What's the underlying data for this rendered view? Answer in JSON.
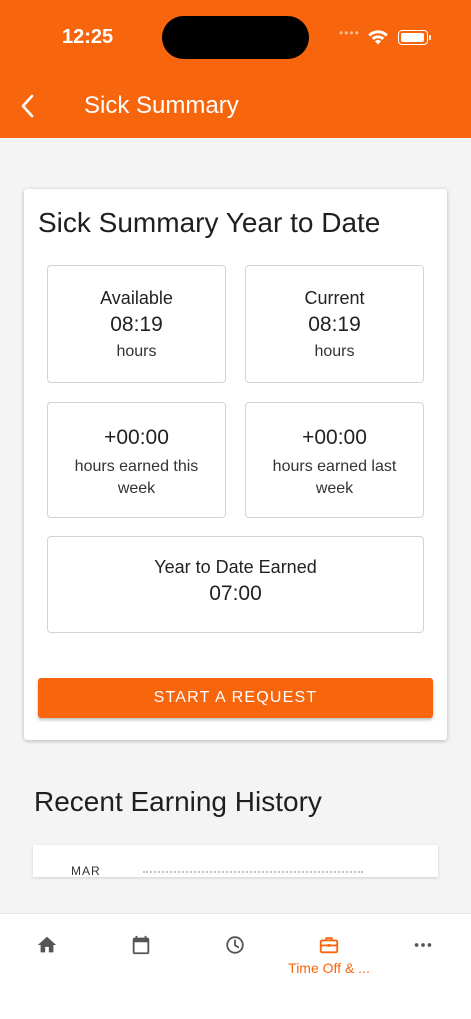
{
  "status_bar": {
    "time": "12:25",
    "dots": "••••"
  },
  "header": {
    "title": "Sick Summary"
  },
  "summary": {
    "title": "Sick Summary Year to Date",
    "available": {
      "label": "Available",
      "value": "08:19",
      "unit": "hours"
    },
    "current": {
      "label": "Current",
      "value": "08:19",
      "unit": "hours"
    },
    "this_week": {
      "value": "+00:00",
      "label": "hours earned this week"
    },
    "last_week": {
      "value": "+00:00",
      "label": "hours earned last week"
    },
    "ytd": {
      "label": "Year to Date Earned",
      "value": "07:00"
    },
    "request_button": "START A REQUEST"
  },
  "history": {
    "title": "Recent Earning History",
    "first_month": "MAR"
  },
  "tabs": [
    {
      "name": "home",
      "label": "",
      "icon": "home-icon"
    },
    {
      "name": "calendar",
      "label": "",
      "icon": "calendar-icon"
    },
    {
      "name": "clock",
      "label": "",
      "icon": "clock-icon"
    },
    {
      "name": "time-off",
      "label": "Time Off & ...",
      "icon": "briefcase-icon",
      "active": true
    },
    {
      "name": "more",
      "label": "",
      "icon": "more-icon"
    }
  ],
  "colors": {
    "accent": "#f7650c",
    "icon_gray": "#555555"
  }
}
